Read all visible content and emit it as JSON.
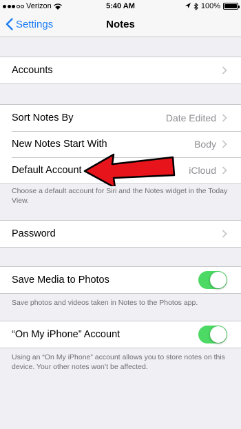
{
  "status_bar": {
    "carrier": "Verizon",
    "time": "5:40 AM",
    "battery": "100%",
    "battery_level": 1.0
  },
  "nav": {
    "back_label": "Settings",
    "title": "Notes"
  },
  "groups": {
    "accounts": {
      "label": "Accounts"
    },
    "sort": {
      "label": "Sort Notes By",
      "value": "Date Edited"
    },
    "new_notes": {
      "label": "New Notes Start With",
      "value": "Body"
    },
    "default_account": {
      "label": "Default Account",
      "value": "iCloud"
    },
    "default_account_footer": "Choose a default account for Siri and the Notes widget in the Today View.",
    "password": {
      "label": "Password"
    },
    "save_media": {
      "label": "Save Media to Photos",
      "enabled": true
    },
    "save_media_footer": "Save photos and videos taken in Notes to the Photos app.",
    "on_my_iphone": {
      "label": "“On My iPhone” Account",
      "enabled": true
    },
    "on_my_iphone_footer": "Using an “On My iPhone” account allows you to store notes on this device. Your other notes won’t be affected."
  },
  "colors": {
    "accent": "#1a7cf5",
    "toggle_on": "#4cd964",
    "annotation_arrow": "#e8141b"
  },
  "icons": [
    "signal-dots-icon",
    "wifi-icon",
    "location-icon",
    "bluetooth-icon",
    "battery-icon",
    "back-chevron-icon",
    "chevron-right-icon",
    "red-arrow-annotation"
  ]
}
